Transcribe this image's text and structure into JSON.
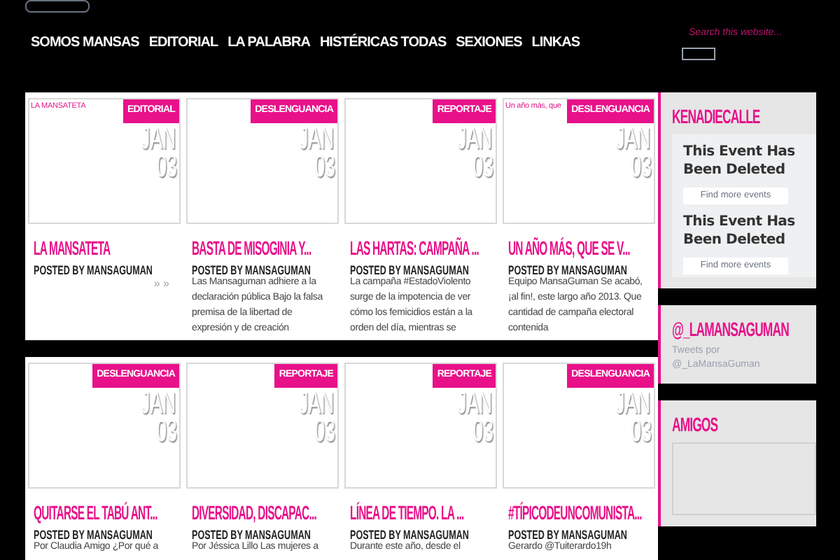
{
  "nav": {
    "items": [
      "SOMOS MANSAS",
      "EDITORIAL",
      "LA PALABRA",
      "HISTÉRICAS TODAS",
      "SEXIONES",
      "LINKAS"
    ]
  },
  "search": {
    "placeholder": "Search this website..."
  },
  "rows": [
    {
      "cards": [
        {
          "alt_text": "LA MANSATETA",
          "category": "EDITORIAL",
          "month": "JAN",
          "day": "03",
          "title": "LA MANSATETA",
          "byline": "POSTED BY MANSAGUMAN",
          "read_more": "» »"
        },
        {
          "category": "DESLENGUANCIA",
          "month": "JAN",
          "day": "03",
          "title": "BASTA DE MISOGINIA Y...",
          "byline": "POSTED BY MANSAGUMAN",
          "excerpt": "Las Mansaguman adhiere a la declaración pública Bajo la falsa premisa de la libertad de expresión y de creación"
        },
        {
          "category": "REPORTAJE",
          "month": "JAN",
          "day": "03",
          "title": "LAS HARTAS: CAMPAÑA ...",
          "byline": "POSTED BY MANSAGUMAN",
          "excerpt": "La campaña #EstadoViolento surge de la impotencia de ver cómo los femicidios están a la orden del día, mientras se"
        },
        {
          "alt_text": "Un año más, que",
          "category": "DESLENGUANCIA",
          "month": "JAN",
          "day": "03",
          "title": "UN AÑO MÁS, QUE SE V...",
          "byline": "POSTED BY MANSAGUMAN",
          "excerpt": "Equipo MansaGuman   Se acabó, ¡al fin!, este largo año 2013. Que cantidad de campaña electoral contenida"
        }
      ]
    },
    {
      "cards": [
        {
          "category": "DESLENGUANCIA",
          "month": "JAN",
          "day": "03",
          "title": "QUITARSE EL TABÚ ANT...",
          "byline": "POSTED BY MANSAGUMAN",
          "excerpt": "Por Claudia Amigo ¿Por qué a"
        },
        {
          "category": "REPORTAJE",
          "month": "JAN",
          "day": "03",
          "title": "DIVERSIDAD, DISCAPAC...",
          "byline": "POSTED BY MANSAGUMAN",
          "excerpt": "Por Jéssica Lillo Las mujeres a"
        },
        {
          "category": "REPORTAJE",
          "month": "JAN",
          "day": "03",
          "title": "LÍNEA DE TIEMPO. LA ...",
          "byline": "POSTED BY MANSAGUMAN",
          "excerpt": "Durante este año, desde el"
        },
        {
          "category": "DESLENGUANCIA",
          "month": "JAN",
          "day": "03",
          "title": "#TÍPICODEUNCOMUNISTA...",
          "byline": "POSTED BY MANSAGUMAN",
          "excerpt": "Gerardo @Tuiterardo19h"
        }
      ]
    }
  ],
  "sidebar": [
    {
      "kind": "events",
      "title": "KENADIECALLE",
      "events": [
        {
          "heading": "This Event Has Been Deleted",
          "button": "Find more events"
        },
        {
          "heading": "This Event Has Been Deleted",
          "button": "Find more events"
        }
      ]
    },
    {
      "kind": "tweets",
      "title": "@_LAMANSAGUMAN",
      "text": "Tweets por @_LaMansaGuman"
    },
    {
      "kind": "box",
      "title": "AMIGOS"
    }
  ]
}
